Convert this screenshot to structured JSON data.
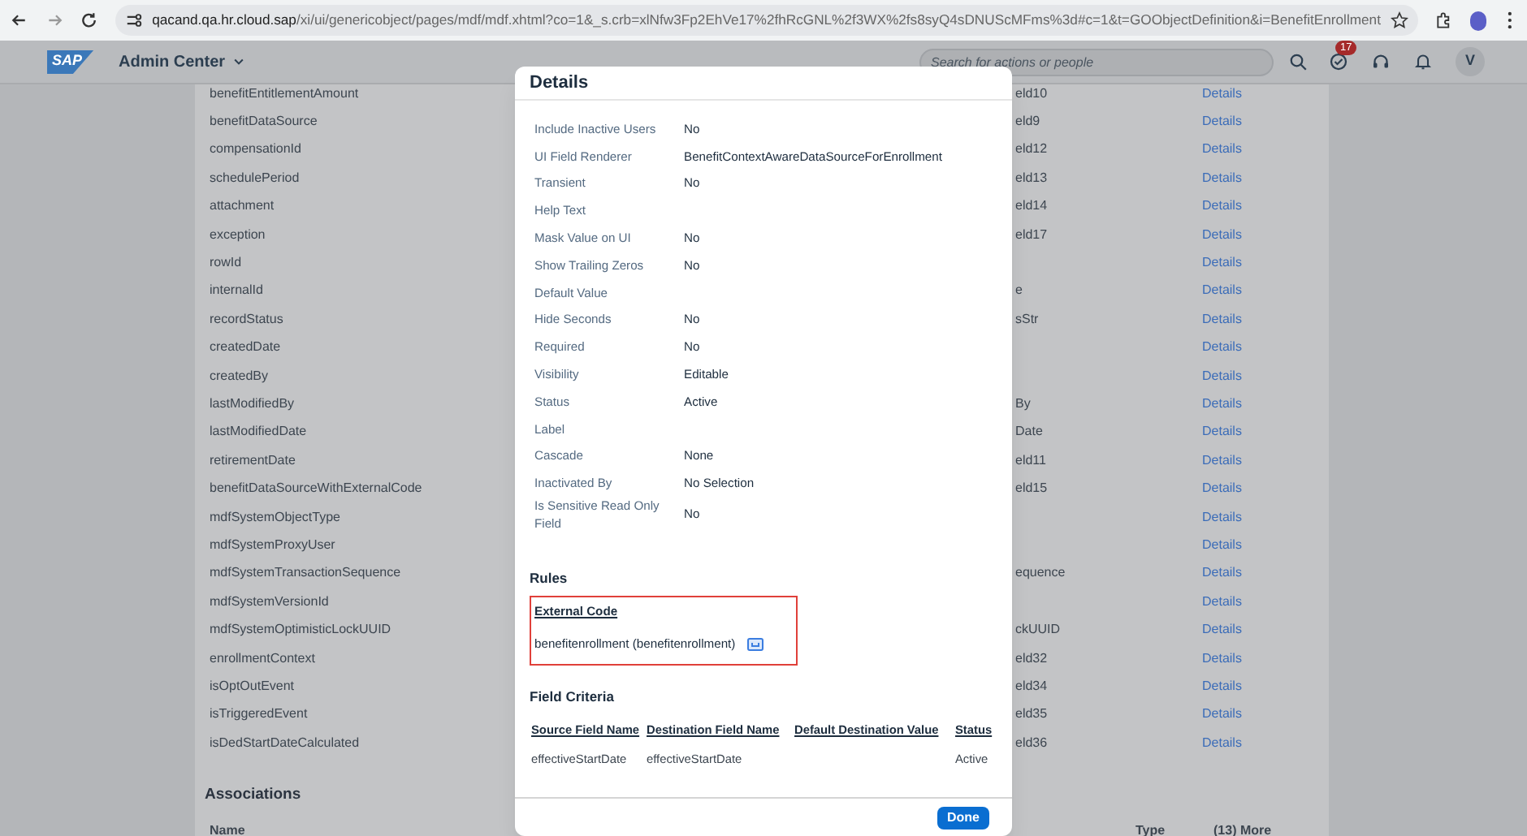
{
  "browser": {
    "url_host": "qacand.qa.hr.cloud.sap",
    "url_path": "/xi/ui/genericobject/pages/mdf/mdf.xhtml?co=1&_s.crb=xlNfw3Fp2EhVe17%2fhRcGNL%2f3WX%2fs8syQ4sDNUScMFms%3d#c=1&t=GOObjectDefinition&i=BenefitEnrollment"
  },
  "header": {
    "logo": "SAP",
    "app_title": "Admin Center",
    "search": {
      "placeholder": "Search for actions or people"
    },
    "notification_count": "17",
    "avatar": "V"
  },
  "fields_table": {
    "rows": [
      {
        "name": "benefitEntitlementAmount",
        "column_2": "eld10",
        "link": "Details"
      },
      {
        "name": "benefitDataSource",
        "column_2": "eld9",
        "link": "Details"
      },
      {
        "name": "compensationId",
        "column_2": "eld12",
        "link": "Details"
      },
      {
        "name": "schedulePeriod",
        "column_2": "eld13",
        "link": "Details"
      },
      {
        "name": "attachment",
        "column_2": "eld14",
        "link": "Details"
      },
      {
        "name": "exception",
        "column_2": "eld17",
        "link": "Details"
      },
      {
        "name": "rowId",
        "link": "Details"
      },
      {
        "name": "internalId",
        "column_2": "e",
        "link": "Details"
      },
      {
        "name": "recordStatus",
        "column_2": "sStr",
        "link": "Details"
      },
      {
        "name": "createdDate",
        "link": "Details"
      },
      {
        "name": "createdBy",
        "link": "Details"
      },
      {
        "name": "lastModifiedBy",
        "column_2": "By",
        "link": "Details"
      },
      {
        "name": "lastModifiedDate",
        "column_2": "Date",
        "link": "Details"
      },
      {
        "name": "retirementDate",
        "column_2": "eld11",
        "link": "Details"
      },
      {
        "name": "benefitDataSourceWithExternalCode",
        "column_2": "eld15",
        "link": "Details"
      },
      {
        "name": "mdfSystemObjectType",
        "link": "Details"
      },
      {
        "name": "mdfSystemProxyUser",
        "link": "Details"
      },
      {
        "name": "mdfSystemTransactionSequence",
        "column_2": "equence",
        "link": "Details"
      },
      {
        "name": "mdfSystemVersionId",
        "link": "Details"
      },
      {
        "name": "mdfSystemOptimisticLockUUID",
        "column_2": "ckUUID",
        "link": "Details"
      },
      {
        "name": "enrollmentContext",
        "column_2": "eld32",
        "link": "Details"
      },
      {
        "name": "isOptOutEvent",
        "column_2": "eld34",
        "link": "Details"
      },
      {
        "name": "isTriggeredEvent",
        "column_2": "eld35",
        "link": "Details"
      },
      {
        "name": "isDedStartDateCalculated",
        "column_2": "eld36",
        "link": "Details"
      }
    ]
  },
  "associations": {
    "title": "Associations",
    "columns": [
      "Name",
      "Type"
    ],
    "more": "(13) More"
  },
  "dialog": {
    "title": "Details",
    "properties": [
      {
        "label": "Include Inactive Users",
        "value": "No"
      },
      {
        "label": "UI Field Renderer",
        "value": "BenefitContextAwareDataSourceForEnrollment"
      },
      {
        "label": "Transient",
        "value": "No"
      },
      {
        "label": "Help Text"
      },
      {
        "label": "Mask Value on UI",
        "value": "No"
      },
      {
        "label": "Show Trailing Zeros",
        "value": "No"
      },
      {
        "label": "Default Value"
      },
      {
        "label": "Hide Seconds",
        "value": "No"
      },
      {
        "label": "Required",
        "value": "No"
      },
      {
        "label": "Visibility",
        "value": "Editable"
      },
      {
        "label": "Status",
        "value": "Active"
      },
      {
        "label": "Label"
      },
      {
        "label": "Cascade",
        "value": "None"
      },
      {
        "label": "Inactivated By",
        "value": "No Selection"
      },
      {
        "label": "Is Sensitive Read Only Field",
        "value": "No"
      }
    ],
    "rules": {
      "title": "Rules",
      "rule_name": "External Code",
      "rule_value": "benefitenrollment (benefitenrollment)"
    },
    "field_criteria": {
      "title": "Field Criteria",
      "columns": [
        "Source Field Name",
        "Destination Field Name",
        "Default Destination Value",
        "Status"
      ],
      "rows": [
        [
          "effectiveStartDate",
          "effectiveStartDate",
          "",
          "Active"
        ]
      ]
    },
    "done_button": "Done"
  }
}
